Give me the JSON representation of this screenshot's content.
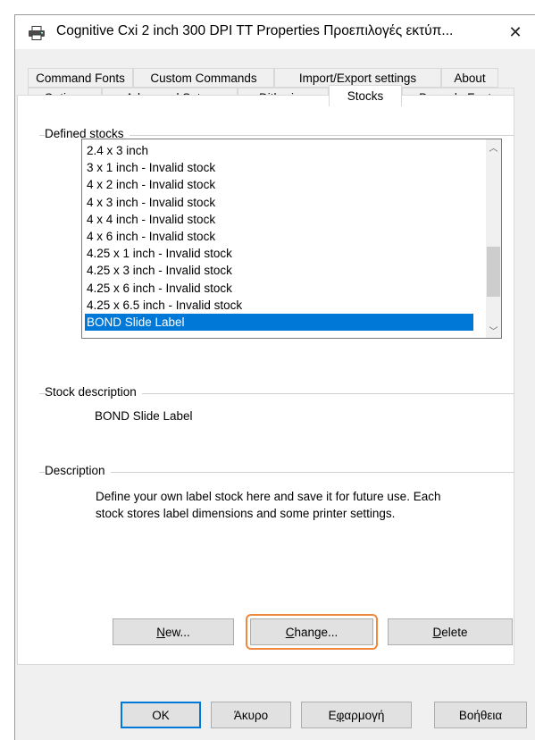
{
  "title": "Cognitive Cxi 2 inch 300 DPI TT Properties Προεπιλογές εκτύπ...",
  "close_glyph": "✕",
  "tabs_back": [
    {
      "label": "Command Fonts"
    },
    {
      "label": "Custom Commands"
    },
    {
      "label": "Import/Export settings"
    },
    {
      "label": "About"
    }
  ],
  "tabs_front": [
    {
      "label": "Options"
    },
    {
      "label": "Advanced Setup"
    },
    {
      "label": "Dithering"
    },
    {
      "label": "Stocks"
    },
    {
      "label": "Barcode Fonts"
    }
  ],
  "active_tab": "Stocks",
  "defined_stocks": {
    "label": "Defined stocks",
    "items": [
      "2.4 x 3 inch",
      "3 x 1 inch - Invalid stock",
      "4 x 2 inch - Invalid stock",
      "4 x 3 inch - Invalid stock",
      "4 x 4 inch - Invalid stock",
      "4 x 6 inch - Invalid stock",
      "4.25 x 1 inch - Invalid stock",
      "4.25 x 3 inch - Invalid stock",
      "4.25 x 6 inch - Invalid stock",
      "4.25 x 6.5 inch - Invalid stock",
      "BOND Slide Label"
    ],
    "selected": "BOND Slide Label"
  },
  "stock_description": {
    "label": "Stock description",
    "value": "BOND Slide Label"
  },
  "description": {
    "label": "Description",
    "line1": "Define your own label stock here and save it for future use. Each",
    "line2": "stock stores label dimensions and some printer settings."
  },
  "stock_buttons": {
    "new": {
      "pre": "",
      "u": "N",
      "post": "ew..."
    },
    "change": {
      "pre": "",
      "u": "C",
      "post": "hange..."
    },
    "delete": {
      "pre": "",
      "u": "D",
      "post": "elete"
    }
  },
  "dialog_buttons": {
    "ok": "OK",
    "cancel": "Άκυρο",
    "apply": {
      "pre": "Ε",
      "u": "φ",
      "post": "αρμογή"
    },
    "help": "Βοήθεια"
  },
  "colors": {
    "selection": "#0078d7",
    "focus_ring": "#f0883e"
  }
}
